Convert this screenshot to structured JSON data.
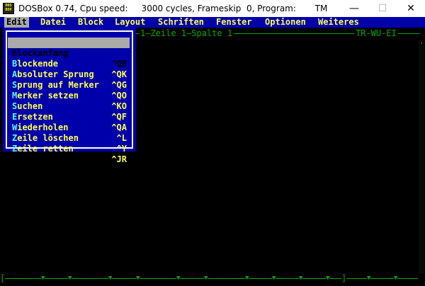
{
  "window": {
    "title": "DOSBox 0.74, Cpu speed:     3000 cycles, Frameskip  0, Program:       TM",
    "icon_name": "dosbox-icon",
    "icon_text": "DOS BOX",
    "controls": {
      "minimize": "—",
      "maximize": "☐",
      "close": "✕"
    }
  },
  "menubar": {
    "items": [
      "Edit",
      "Datei",
      "Block",
      "Layout",
      "Schriften",
      "Fenster",
      "Optionen",
      "Weiteres"
    ],
    "active_index": 0
  },
  "status_line": {
    "text": "1—Zeile 1—Spalte 1",
    "mode": "TR-WU-EI"
  },
  "edit_menu": {
    "selected_index": 0,
    "items": [
      {
        "hotkey": "B",
        "rest": "lockanfang",
        "shortcut": "^QB"
      },
      {
        "hotkey": "B",
        "rest": "lockende",
        "shortcut": "^QK"
      },
      {
        "hotkey": "A",
        "rest": "bsoluter Sprung",
        "shortcut": "^QG"
      },
      {
        "hotkey": "S",
        "rest": "prung auf Merker",
        "shortcut": "^QO"
      },
      {
        "hotkey": "M",
        "rest": "erker setzen",
        "shortcut": "^KO"
      },
      {
        "hotkey": "S",
        "rest": "uchen",
        "shortcut": "^QF"
      },
      {
        "hotkey": "E",
        "rest": "rsetzen",
        "shortcut": "^QA"
      },
      {
        "hotkey": "W",
        "rest": "iederholen",
        "shortcut": "^L"
      },
      {
        "hotkey": "Z",
        "rest": "eile löschen",
        "shortcut": "^Y"
      },
      {
        "hotkey": "Z",
        "rest": "eile retten",
        "shortcut": "^JR"
      }
    ]
  },
  "ruler": {
    "start": "[",
    "end": "]",
    "tab_glyph": "▼"
  },
  "colors": {
    "menu_bg": "#0000aa",
    "menu_text": "#ffff55",
    "hotkey": "#55ffff",
    "highlight": "#aaaaaa",
    "frame_green": "#00aa00"
  }
}
